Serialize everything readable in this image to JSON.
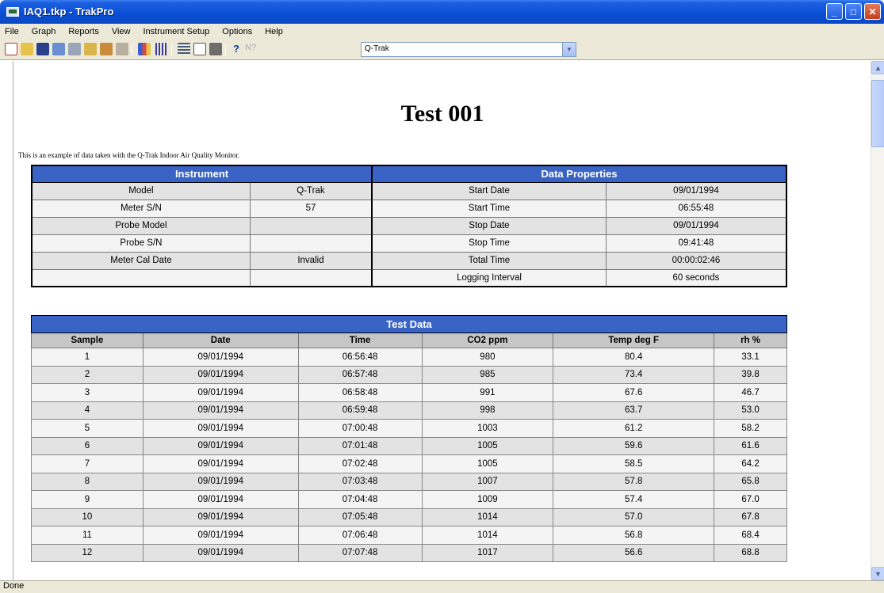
{
  "window": {
    "title": "IAQ1.tkp - TrakPro",
    "controls": {
      "minimize": "_",
      "maximize": "□",
      "close": "✕"
    }
  },
  "menu": [
    "File",
    "Graph",
    "Reports",
    "View",
    "Instrument Setup",
    "Options",
    "Help"
  ],
  "toolbar": {
    "icons": [
      "new-icon",
      "open-icon",
      "save-icon",
      "properties-icon",
      "download-icon",
      "probe-icon",
      "instrument-icon",
      "instrument-setup-icon",
      "bar-graph-icon",
      "columns-icon",
      "list-icon",
      "print-preview-icon",
      "print-icon",
      "help-icon",
      "context-help-icon"
    ],
    "instrument_combo": "Q-Trak"
  },
  "report": {
    "title": "Test 001",
    "description": "This is an example of data taken with the Q-Trak Indoor Air Quality Monitor.",
    "properties": {
      "instrument_header": "Instrument",
      "data_header": "Data Properties",
      "rows": [
        {
          "ilabel": "Model",
          "ivalue": "Q-Trak",
          "dlabel": "Start Date",
          "dvalue": "09/01/1994"
        },
        {
          "ilabel": "Meter S/N",
          "ivalue": "57",
          "dlabel": "Start Time",
          "dvalue": "06:55:48"
        },
        {
          "ilabel": "Probe Model",
          "ivalue": "",
          "dlabel": "Stop Date",
          "dvalue": "09/01/1994"
        },
        {
          "ilabel": "Probe S/N",
          "ivalue": "",
          "dlabel": "Stop Time",
          "dvalue": "09:41:48"
        },
        {
          "ilabel": "Meter Cal Date",
          "ivalue": "Invalid",
          "dlabel": "Total Time",
          "dvalue": "00:00:02:46"
        },
        {
          "ilabel": "",
          "ivalue": "",
          "dlabel": "Logging Interval",
          "dvalue": "60 seconds"
        }
      ]
    },
    "test_data": {
      "caption": "Test Data",
      "columns": [
        "Sample",
        "Date",
        "Time",
        "CO2 ppm",
        "Temp deg F",
        "rh %"
      ],
      "rows": [
        [
          "1",
          "09/01/1994",
          "06:56:48",
          "980",
          "80.4",
          "33.1"
        ],
        [
          "2",
          "09/01/1994",
          "06:57:48",
          "985",
          "73.4",
          "39.8"
        ],
        [
          "3",
          "09/01/1994",
          "06:58:48",
          "991",
          "67.6",
          "46.7"
        ],
        [
          "4",
          "09/01/1994",
          "06:59:48",
          "998",
          "63.7",
          "53.0"
        ],
        [
          "5",
          "09/01/1994",
          "07:00:48",
          "1003",
          "61.2",
          "58.2"
        ],
        [
          "6",
          "09/01/1994",
          "07:01:48",
          "1005",
          "59.6",
          "61.6"
        ],
        [
          "7",
          "09/01/1994",
          "07:02:48",
          "1005",
          "58.5",
          "64.2"
        ],
        [
          "8",
          "09/01/1994",
          "07:03:48",
          "1007",
          "57.8",
          "65.8"
        ],
        [
          "9",
          "09/01/1994",
          "07:04:48",
          "1009",
          "57.4",
          "67.0"
        ],
        [
          "10",
          "09/01/1994",
          "07:05:48",
          "1014",
          "57.0",
          "67.8"
        ],
        [
          "11",
          "09/01/1994",
          "07:06:48",
          "1014",
          "56.8",
          "68.4"
        ],
        [
          "12",
          "09/01/1994",
          "07:07:48",
          "1017",
          "56.6",
          "68.8"
        ]
      ]
    }
  },
  "status": "Done"
}
